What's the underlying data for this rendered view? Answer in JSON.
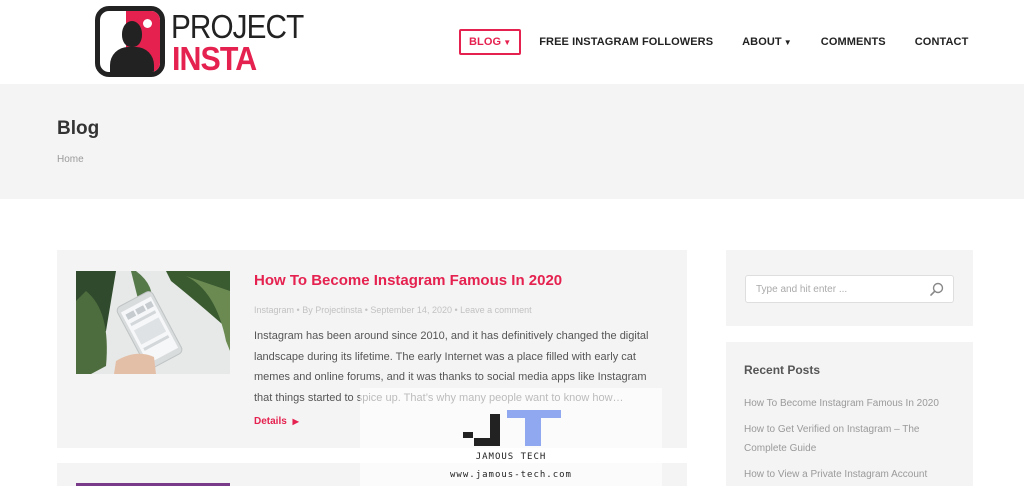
{
  "logo": {
    "line1": "PROJECT",
    "line2": "INSTA"
  },
  "nav": [
    {
      "label": "BLOG",
      "active": true,
      "dropdown": true
    },
    {
      "label": "FREE INSTAGRAM FOLLOWERS",
      "active": false,
      "dropdown": false
    },
    {
      "label": "ABOUT",
      "active": false,
      "dropdown": true
    },
    {
      "label": "COMMENTS",
      "active": false,
      "dropdown": false
    },
    {
      "label": "CONTACT",
      "active": false,
      "dropdown": false
    }
  ],
  "page": {
    "title": "Blog",
    "breadcrumb": "Home"
  },
  "post": {
    "title": "How To Become Instagram Famous In 2020",
    "meta": {
      "category": "Instagram",
      "author": "By Projectinsta",
      "date": "September 14, 2020",
      "comments": "Leave a comment"
    },
    "excerpt": "Instagram has been around since 2010, and it has definitively changed the digital landscape during its lifetime. The early Internet was a place filled with early cat memes and online forums, and it was thanks to social media apps like Instagram that things started to spice up. That’s why many people want to know how…",
    "details_label": "Details"
  },
  "sidebar": {
    "search_placeholder": "Type and hit enter ...",
    "recent_title": "Recent Posts",
    "recent_posts": [
      "How To Become Instagram Famous In 2020",
      "How to Get Verified on Instagram – The Complete Guide",
      "How to View a Private Instagram Account"
    ]
  },
  "watermark": {
    "brand": "JAMOUS TECH",
    "url": "www.jamous-tech.com"
  },
  "colors": {
    "accent": "#e5214f",
    "panel": "#f4f4f4",
    "text": "#333333"
  },
  "icons": {
    "search": "search-icon",
    "caret": "chevron-down-icon",
    "arrow": "arrow-right-icon"
  }
}
